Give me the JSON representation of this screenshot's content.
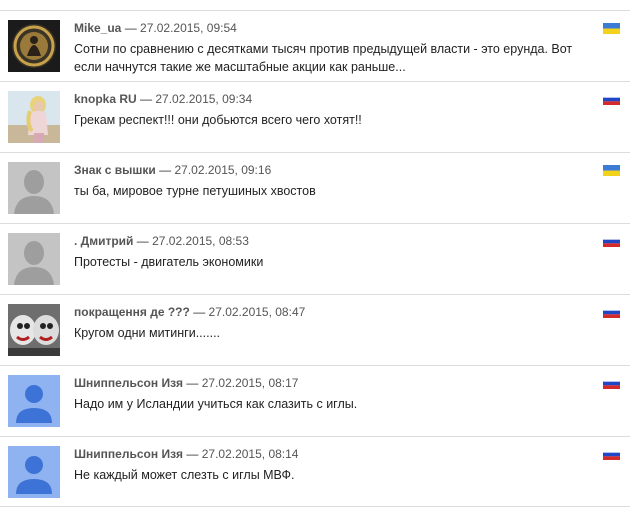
{
  "comments": [
    {
      "author": "Mike_ua",
      "date": "27.02.2015, 09:54",
      "text": "Сотни по сравнению с десятками тысяч против предыдущей власти - это ерунда. Вот если начнутся такие же масштабные акции как раньше...",
      "flag": "ukraine-flag",
      "avatar": "dark-emblem-avatar"
    },
    {
      "author": "knopka RU",
      "date": "27.02.2015, 09:34",
      "text": "Грекам респект!!! они добьются всего чего хотят!!",
      "flag": "russia-flag",
      "avatar": "blonde-woman-photo-avatar"
    },
    {
      "author": "Знак с вышки",
      "date": "27.02.2015, 09:16",
      "text": "ты ба, мировое турне петушиных хвостов",
      "flag": "ukraine-flag",
      "avatar": "default-gray-person-avatar"
    },
    {
      "author": ". Дмитрий",
      "date": "27.02.2015, 08:53",
      "text": "Протесты - двигатель экономики",
      "flag": "russia-flag",
      "avatar": "default-gray-person-avatar"
    },
    {
      "author": "покращення де ???",
      "date": "27.02.2015, 08:47",
      "text": "Кругом одни митинги.......",
      "flag": "russia-flag",
      "avatar": "photo-avatar"
    },
    {
      "author": "Шниппельсон Изя",
      "date": "27.02.2015, 08:17",
      "text": "Надо им у Исландии учиться как слазить с иглы.",
      "flag": "russia-flag",
      "avatar": "default-blue-person-avatar"
    },
    {
      "author": "Шниппельсон Изя",
      "date": "27.02.2015, 08:14",
      "text": "Не каждый может слезть с иглы МВФ.",
      "flag": "russia-flag",
      "avatar": "default-blue-person-avatar"
    }
  ],
  "separator": "—",
  "colors": {
    "border": "#dcdcdc",
    "blue_avatar_bg": "#8fb3f0",
    "blue_avatar_fg": "#3d73d6",
    "gray_avatar_bg": "#c4c4c4",
    "gray_avatar_fg": "#9e9e9e"
  }
}
